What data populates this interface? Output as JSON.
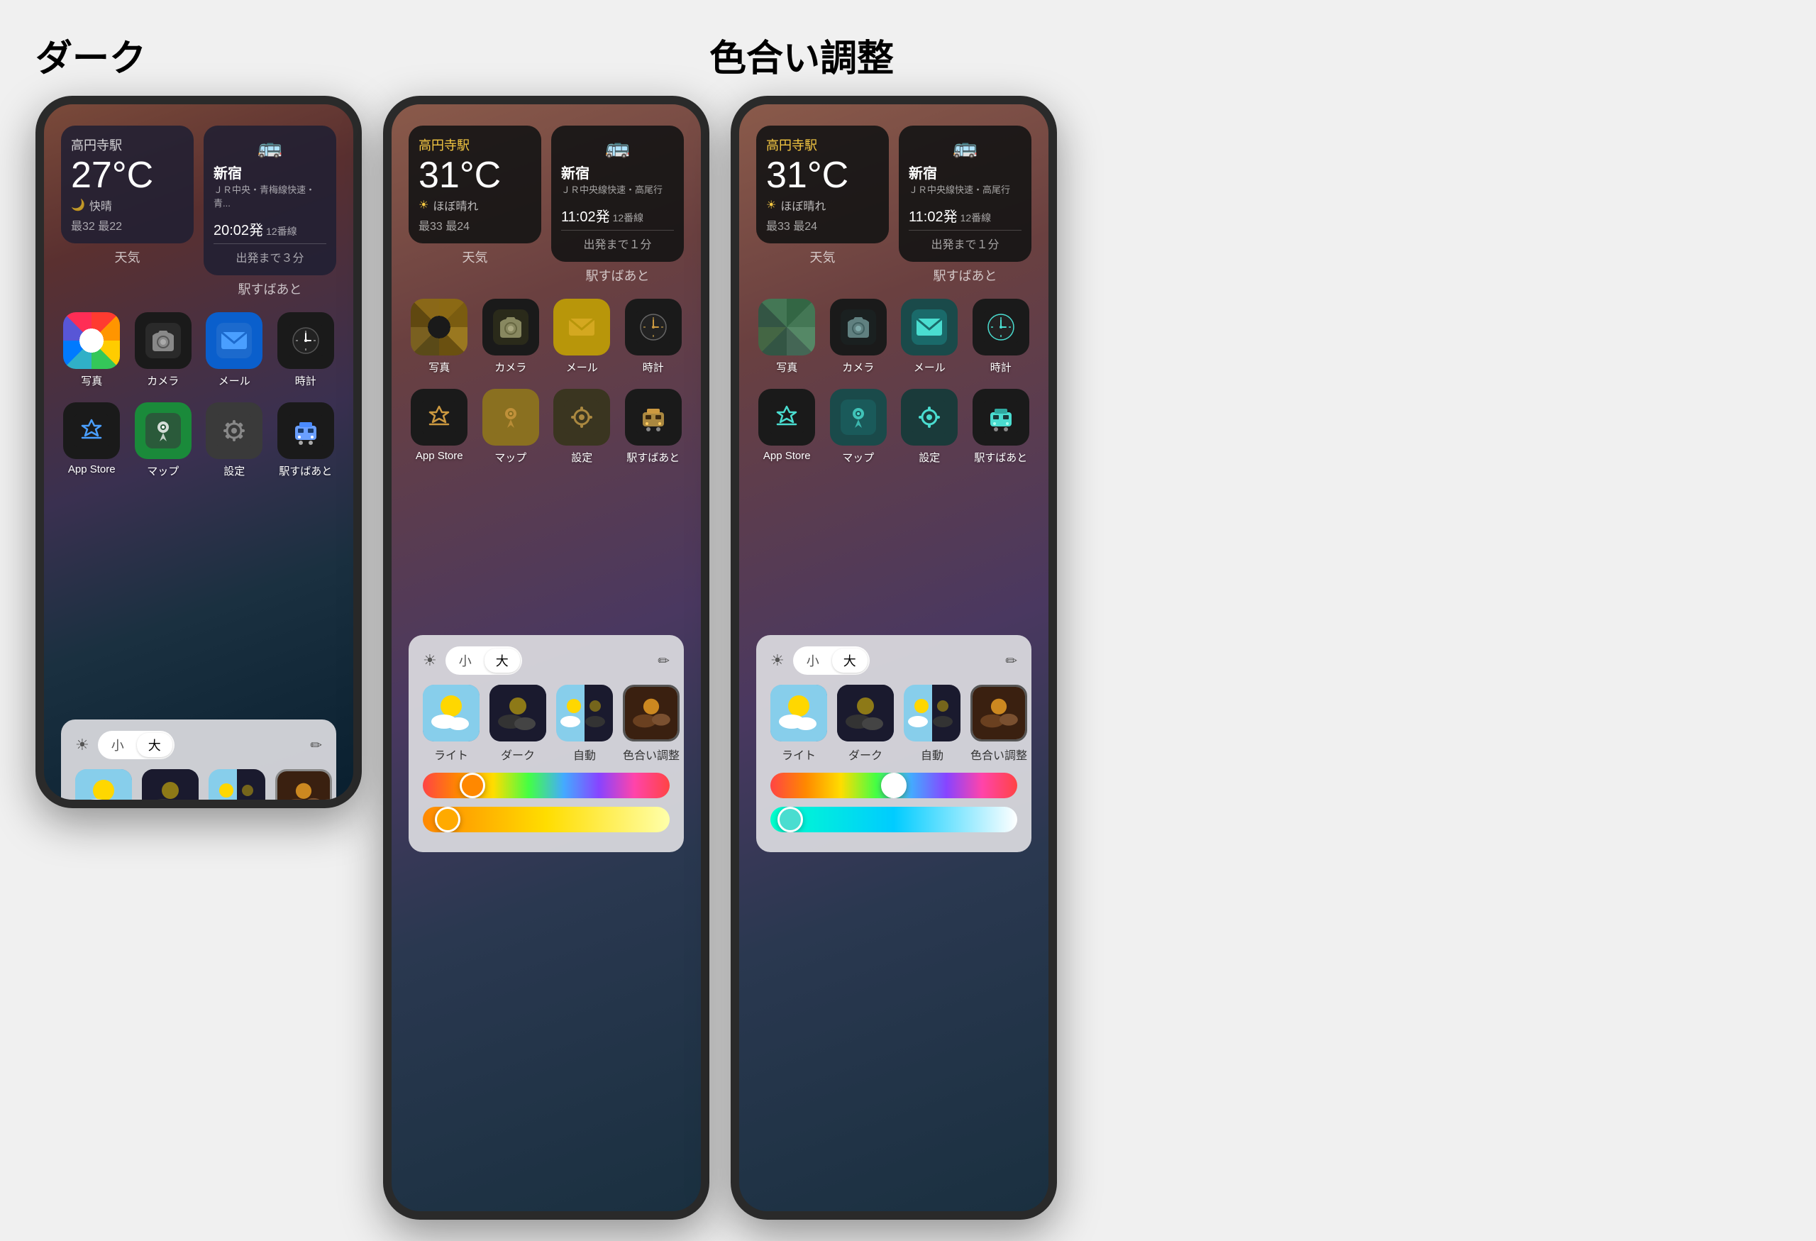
{
  "labels": {
    "dark_title": "ダーク",
    "tint_title": "色合い調整",
    "weather_label": "天気",
    "train_label": "駅すばあと",
    "photo_label": "写真",
    "camera_label": "カメラ",
    "mail_label": "メール",
    "clock_label": "時計",
    "appstore_label": "App Store",
    "maps_label": "マップ",
    "settings_label": "設定",
    "ekisubaato_label": "駅すばあと",
    "small_label": "小",
    "large_label": "大",
    "theme_light": "ライト",
    "theme_dark": "ダーク",
    "theme_auto": "自動",
    "theme_tint": "色合い調整"
  },
  "dark_phone": {
    "weather": {
      "station": "高円寺駅",
      "temp": "27°C",
      "condition": "快晴",
      "moon_icon": "🌙",
      "high": "32",
      "low": "22",
      "high_label": "最",
      "low_label": "最"
    },
    "train": {
      "icon": "🚌",
      "destination": "新宿",
      "line": "ＪＲ中央・青梅線快速・青...",
      "time": "20:02",
      "time_suffix": "発",
      "track": "12番線",
      "departure": "出発まで３分"
    }
  },
  "tint_phone": {
    "weather": {
      "station": "高円寺駅",
      "temp": "31°C",
      "condition": "ほぼ晴れ",
      "high": "33",
      "low": "24"
    },
    "train": {
      "destination": "新宿",
      "line": "ＪＲ中央線快速・高尾行",
      "time": "11:02",
      "time_suffix": "発",
      "track": "12番線",
      "departure": "出発まで１分"
    }
  },
  "tint_phone2": {
    "weather": {
      "station": "高円寺駅",
      "temp": "31°C",
      "condition": "ほぼ晴れ",
      "high": "33",
      "low": "24"
    },
    "train": {
      "destination": "新宿",
      "line": "ＪＲ中央線快速・高尾行",
      "time": "11:02",
      "time_suffix": "発",
      "track": "12番線",
      "departure": "出発まで１分"
    }
  },
  "colors": {
    "tint_yellow": "#f5c842",
    "tint_cyan": "#4dd0c4",
    "bg_dark": "#1a1a1a",
    "panel_bg": "rgba(220,220,225,0.92)"
  }
}
